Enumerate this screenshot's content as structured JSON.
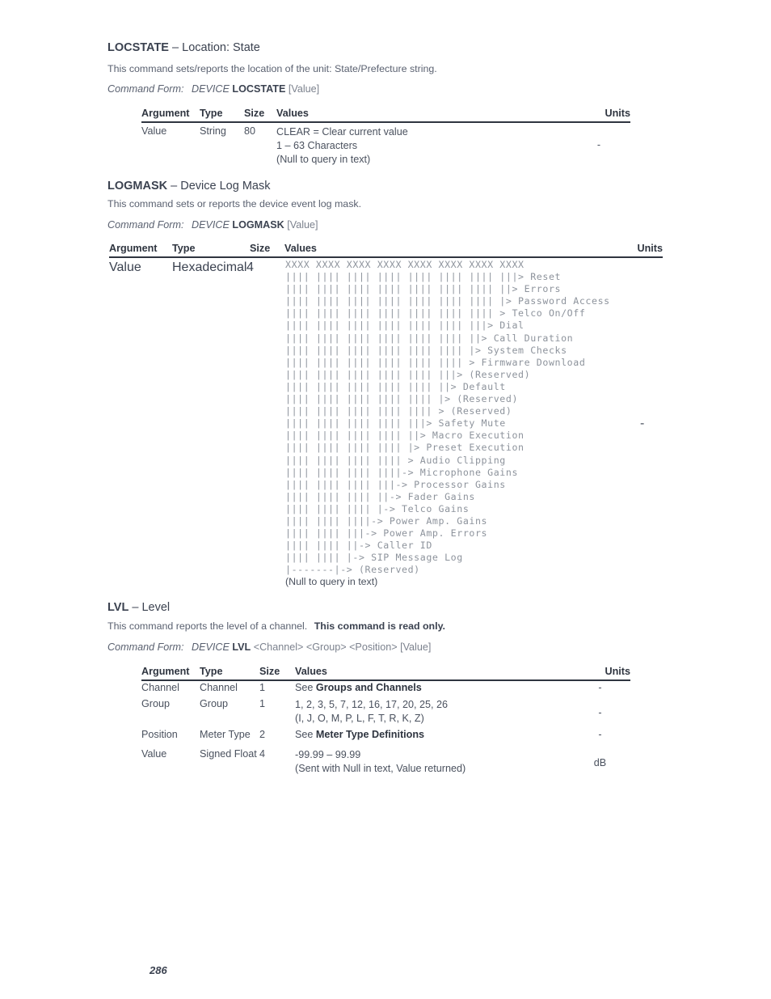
{
  "page": {
    "number": "286"
  },
  "table_headers": {
    "argument": "Argument",
    "type": "Type",
    "size": "Size",
    "values": "Values",
    "units": "Units"
  },
  "command_form_label": "Command Form:",
  "device_keyword": "DEVICE",
  "sections": [
    {
      "id": "locstate",
      "name": "LOCSTATE",
      "dash": "–",
      "description_title": "Location: State",
      "description": "This command sets/reports the location of the unit: State/Prefecture string.",
      "form_args": "[Value]",
      "rows": [
        {
          "argument": "Value",
          "type": "String",
          "size": "80",
          "values": [
            "CLEAR = Clear current value",
            "1 – 63 Characters",
            "(Null to query in text)"
          ],
          "units": "-"
        }
      ]
    },
    {
      "id": "logmask",
      "name": "LOGMASK",
      "dash": "–",
      "description_title": "Device Log Mask",
      "description": "This command sets or reports the device event log mask.",
      "form_args": "[Value]",
      "rows": [
        {
          "argument": "Value",
          "type": "Hexadecimal",
          "size": "4",
          "units": "-"
        }
      ],
      "bitmask": {
        "bit_row": "XXXX XXXX XXXX XXXX XXXX XXXX XXXX XXXX",
        "labels": [
          "Reset",
          "Errors",
          "Password Access",
          "Telco On/Off",
          "Dial",
          "Call Duration",
          "System Checks",
          "Firmware Download",
          "(Reserved)",
          "Default",
          "(Reserved)",
          "(Reserved)",
          "Safety Mute",
          "Macro Execution",
          "Preset Execution",
          "Audio Clipping",
          "Microphone Gains",
          "Processor Gains",
          "Fader Gains",
          "Telco Gains",
          "Power Amp. Gains",
          "Power Amp. Errors",
          "Caller ID",
          "SIP Message Log"
        ],
        "final_row_label": "(Reserved)",
        "null_note": "(Null to query in text)"
      }
    },
    {
      "id": "lvl",
      "name": "LVL",
      "dash": "–",
      "description_title": "Level",
      "description": "This command reports the level of a channel.",
      "description_bold": "This command is read only.",
      "form_args_parts": [
        "<Channel>",
        "<Group>",
        "<Position>"
      ],
      "form_optional": "[Value]",
      "rows": [
        {
          "argument": "Channel",
          "type": "Channel",
          "size": "1",
          "values_prefix": "See ",
          "values_bold": "Groups and Channels",
          "units": "-"
        },
        {
          "argument": "Group",
          "type": "Group",
          "size": "1",
          "values": [
            "1, 2, 3, 5, 7, 12, 16, 17, 20, 25, 26",
            "(I, J, O, M, P, L, F, T, R, K, Z)"
          ],
          "units": "-"
        },
        {
          "argument": "Position",
          "type": "Meter Type",
          "size": "2",
          "values_prefix": "See ",
          "values_bold": "Meter Type Definitions",
          "units": "-"
        },
        {
          "argument": "Value",
          "type": "Signed Float",
          "size": "4",
          "values": [
            "-99.99 – 99.99",
            "(Sent with Null in text, Value returned)"
          ],
          "units": "dB"
        }
      ]
    }
  ]
}
